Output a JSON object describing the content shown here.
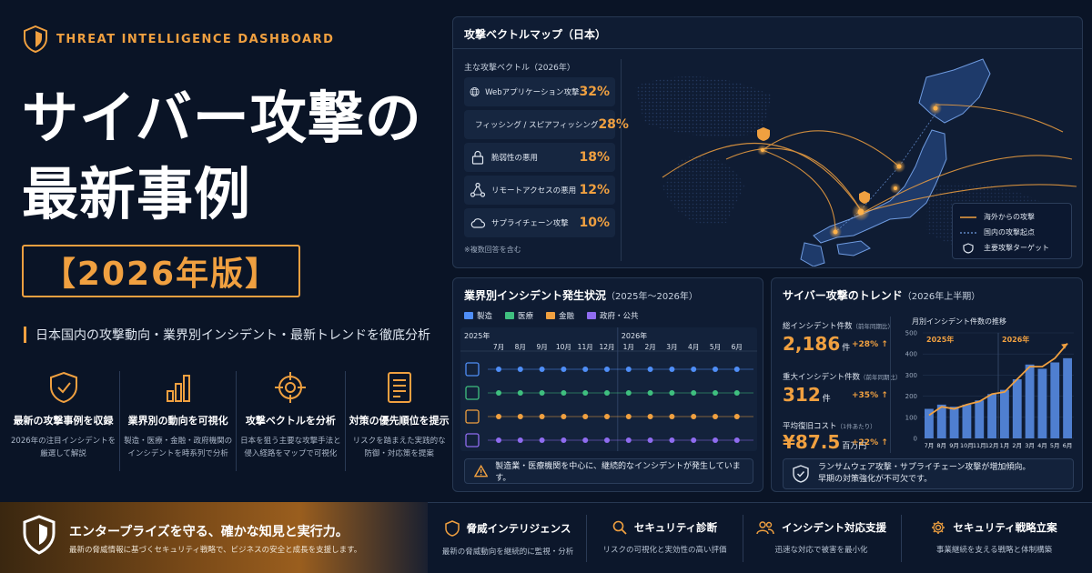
{
  "header": {
    "tagline": "THREAT INTELLIGENCE DASHBOARD",
    "title_line1": "サイバー攻撃の",
    "title_line2": "最新事例",
    "badge": "【2026年版】",
    "subtitle": "日本国内の攻撃動向・業界別インシデント・最新トレンドを徹底分析"
  },
  "features": [
    {
      "icon": "shield-check-icon",
      "title": "最新の攻撃事例を収録",
      "desc1": "2026年の注目インシデントを",
      "desc2": "厳選して解説"
    },
    {
      "icon": "bar-chart-icon",
      "title": "業界別の動向を可視化",
      "desc1": "製造・医療・金融・政府機関の",
      "desc2": "インシデントを時系列で分析"
    },
    {
      "icon": "target-icon",
      "title": "攻撃ベクトルを分析",
      "desc1": "日本を狙う主要な攻撃手法と",
      "desc2": "侵入経路をマップで可視化"
    },
    {
      "icon": "checklist-icon",
      "title": "対策の優先順位を提示",
      "desc1": "リスクを踏まえた実践的な",
      "desc2": "防御・対応策を提案"
    }
  ],
  "map_panel": {
    "title": "攻撃ベクトルマップ（日本）",
    "vectors_title": "主な攻撃ベクトル（2026年）",
    "vectors": [
      {
        "icon": "globe-icon",
        "label": "Webアプリケーション攻撃",
        "pct": "32%"
      },
      {
        "icon": "mail-icon",
        "label": "フィッシング / スピアフィッシング",
        "pct": "28%"
      },
      {
        "icon": "lock-icon",
        "label": "脆弱性の悪用",
        "pct": "18%"
      },
      {
        "icon": "network-icon",
        "label": "リモートアクセスの悪用",
        "pct": "12%"
      },
      {
        "icon": "cloud-icon",
        "label": "サプライチェーン攻撃",
        "pct": "10%"
      }
    ],
    "note": "※複数回答を含む",
    "legend": {
      "overseas": "海外からの攻撃",
      "domestic": "国内の攻撃起点",
      "target": "主要攻撃ターゲット"
    }
  },
  "industry_panel": {
    "title": "業界別インシデント発生状況",
    "period": "（2025年〜2026年）",
    "legend": [
      {
        "label": "製造",
        "color": "#4f8ef7"
      },
      {
        "label": "医療",
        "color": "#3fbf7f"
      },
      {
        "label": "金融",
        "color": "#f0a040"
      },
      {
        "label": "政府・公共",
        "color": "#8f6cf0"
      }
    ],
    "year_2025": "2025年",
    "year_2026": "2026年",
    "months": [
      "7月",
      "8月",
      "9月",
      "10月",
      "11月",
      "12月",
      "1月",
      "2月",
      "3月",
      "4月",
      "5月",
      "6月"
    ],
    "alert": "製造業・医療機関を中心に、継続的なインシデントが発生しています。"
  },
  "trend_panel": {
    "title": "サイバー攻撃のトレンド",
    "period": "（2026年上半期）",
    "kpis": [
      {
        "label": "総インシデント件数",
        "note": "（前年同期比）",
        "value": "2,186",
        "unit": "件",
        "change": "+28%"
      },
      {
        "label": "重大インシデント件数",
        "note": "（前年同期比）",
        "value": "312",
        "unit": "件",
        "change": "+35%"
      },
      {
        "label": "平均復旧コスト",
        "note": "（1件あたり）",
        "value": "¥87.5",
        "unit": "百万円",
        "change": "+22%"
      }
    ],
    "alert_line1": "ランサムウェア攻撃・サプライチェーン攻撃が増加傾向。",
    "alert_line2": "早期の対策強化が不可欠です。"
  },
  "chart_data": {
    "type": "bar",
    "title": "月別インシデント件数の推移",
    "categories": [
      "7月",
      "8月",
      "9月",
      "10月",
      "11月",
      "12月",
      "1月",
      "2月",
      "3月",
      "4月",
      "5月",
      "6月"
    ],
    "values": [
      140,
      160,
      150,
      160,
      180,
      210,
      230,
      280,
      350,
      330,
      360,
      380
    ],
    "trend_line": [
      110,
      150,
      140,
      160,
      175,
      210,
      220,
      280,
      340,
      340,
      380,
      450
    ],
    "ylim": [
      0,
      500
    ],
    "yticks": [
      "0",
      "100",
      "200",
      "300",
      "400",
      "500"
    ],
    "year_labels": [
      "2025年",
      "2026年"
    ],
    "colors": {
      "bar": "#4f7fd0",
      "line": "#f0a040"
    }
  },
  "footer": {
    "brand_title": "エンタープライズを守る、確かな知見と実行力。",
    "brand_desc": "最新の脅威情報に基づくセキュリティ戦略で、ビジネスの安全と成長を支援します。",
    "services": [
      {
        "icon": "shield-icon",
        "title": "脅威インテリジェンス",
        "desc": "最新の脅威動向を継続的に監視・分析"
      },
      {
        "icon": "search-icon",
        "title": "セキュリティ診断",
        "desc": "リスクの可視化と実効性の高い評価"
      },
      {
        "icon": "team-icon",
        "title": "インシデント対応支援",
        "desc": "迅速な対応で被害を最小化"
      },
      {
        "icon": "gear-icon",
        "title": "セキュリティ戦略立案",
        "desc": "事業継続を支える戦略と体制構築"
      }
    ]
  }
}
